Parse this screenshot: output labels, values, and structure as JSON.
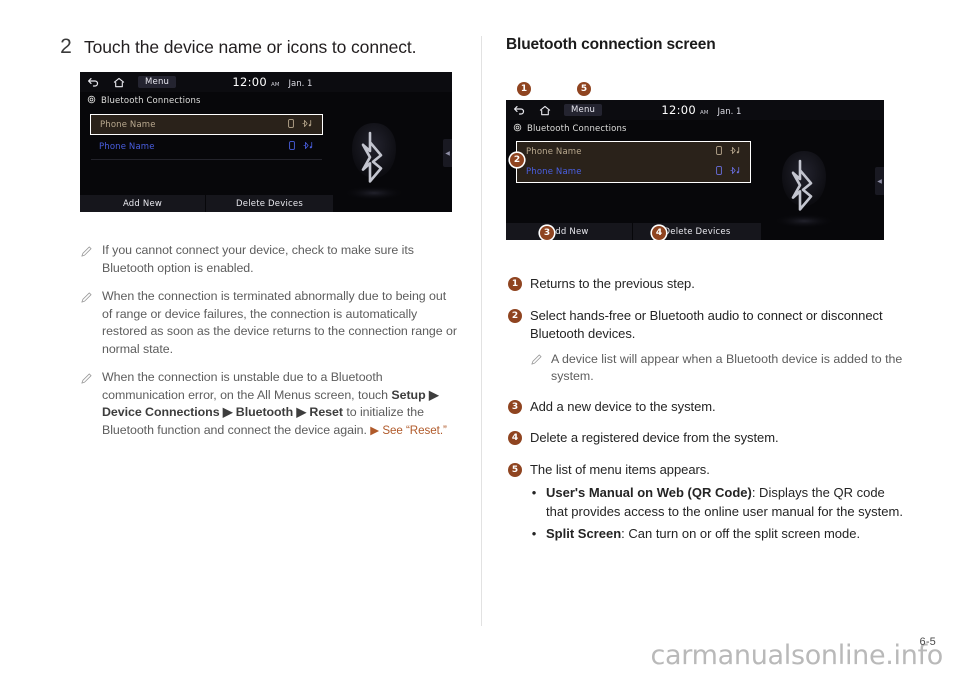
{
  "page": {
    "number": "6-5",
    "watermark": "carmanualsonline.info"
  },
  "left": {
    "step": {
      "number": "2",
      "text": "Touch the device name or icons to connect."
    },
    "screen": {
      "back_icon": "back-arrow-icon",
      "home_icon": "home-icon",
      "menu_label": "Menu",
      "time": "12:00",
      "ampm": "AM",
      "date": "Jan. 1",
      "gear_icon": "gear-icon",
      "title": "Bluetooth Connections",
      "devices": [
        {
          "name": "Phone Name",
          "state": "selected",
          "phone_icon": "phone-icon",
          "audio_icon": "bluetooth-audio-icon"
        },
        {
          "name": "Phone Name",
          "state": "connected",
          "phone_icon": "phone-icon",
          "audio_icon": "bluetooth-audio-icon"
        }
      ],
      "buttons": [
        "Add New",
        "Delete Devices"
      ],
      "logo": "bluetooth-logo"
    },
    "notes": [
      {
        "id": "note-bluetooth-enabled",
        "parts": [
          {
            "t": "If you cannot connect your device, check to make sure its Bluetooth option is enabled."
          }
        ]
      },
      {
        "id": "note-auto-restore",
        "parts": [
          {
            "t": "When the connection is terminated abnormally due to being out of range or device failures, the connection is automatically restored as soon as the device returns to the connection range or normal state."
          }
        ]
      },
      {
        "id": "note-reset-path",
        "parts": [
          {
            "t": "When the connection is unstable due to a Bluetooth communication error, on the All Menus screen, touch "
          },
          {
            "t": "Setup",
            "bold": true
          },
          {
            "t": " ▶ ",
            "bold": true
          },
          {
            "t": "Device Connections",
            "bold": true
          },
          {
            "t": " ▶ ",
            "bold": true
          },
          {
            "t": "Bluetooth",
            "bold": true
          },
          {
            "t": " ▶ ",
            "bold": true
          },
          {
            "t": "Reset",
            "bold": true
          },
          {
            "t": " to initialize the Bluetooth function and connect the device again. "
          },
          {
            "t": "▶ See “Reset.”",
            "ref": true
          }
        ]
      }
    ]
  },
  "right": {
    "title": "Bluetooth connection screen",
    "screen": {
      "back_icon": "back-arrow-icon",
      "home_icon": "home-icon",
      "menu_label": "Menu",
      "time": "12:00",
      "ampm": "AM",
      "date": "Jan. 1",
      "gear_icon": "gear-icon",
      "title": "Bluetooth Connections",
      "devices": [
        {
          "name": "Phone Name",
          "state": "selected"
        },
        {
          "name": "Phone Name",
          "state": "connected"
        }
      ],
      "buttons": [
        "Add New",
        "Delete Devices"
      ],
      "logo": "bluetooth-logo"
    },
    "callouts": [
      "1",
      "5",
      "2",
      "3",
      "4"
    ],
    "items": [
      {
        "num": "1",
        "parts": [
          {
            "t": "Returns to the previous step."
          }
        ]
      },
      {
        "num": "2",
        "parts": [
          {
            "t": "Select hands-free or Bluetooth audio to connect or disconnect Bluetooth devices."
          }
        ],
        "note": "A device list will appear when a Bluetooth device is added to the system."
      },
      {
        "num": "3",
        "parts": [
          {
            "t": "Add a new device to the system."
          }
        ]
      },
      {
        "num": "4",
        "parts": [
          {
            "t": "Delete a registered device from the system."
          }
        ]
      },
      {
        "num": "5",
        "parts": [
          {
            "t": "The list of menu items appears."
          }
        ],
        "bullets": [
          [
            {
              "t": "User's Manual on Web (QR Code)",
              "bold": true
            },
            {
              "t": ": Displays the QR code that provides access to the online user manual for the system."
            }
          ],
          [
            {
              "t": "Split Screen",
              "bold": true
            },
            {
              "t": ": Can turn on or off the split screen mode."
            }
          ]
        ]
      }
    ]
  },
  "colors": {
    "accent": "#8f4420",
    "reference_link": "#b05a2a",
    "screen_bg": "#07070a",
    "device_selected": "#b9a98f",
    "device_connected": "#4a5fe0",
    "divider": "#e2e2e2"
  }
}
